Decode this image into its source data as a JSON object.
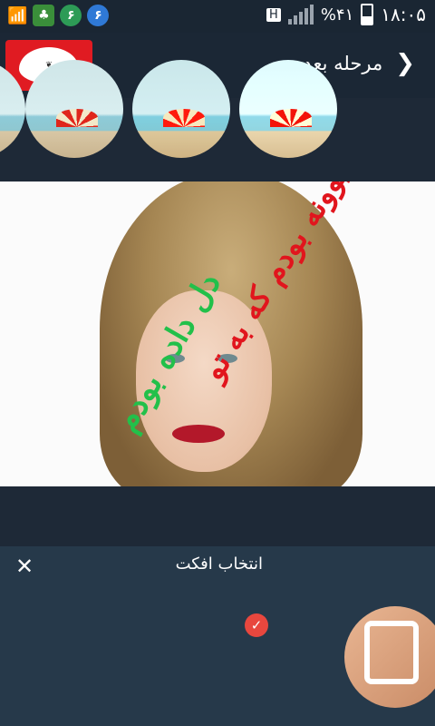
{
  "statusbar": {
    "time": "۱۸:۰۵",
    "battery": "%۴۱",
    "network_type": "H",
    "notif_count_1": "۶",
    "notif_count_2": "۶"
  },
  "appbar": {
    "next_label": "مرحله بعد",
    "next_icon": "chevron-right"
  },
  "photo": {
    "caption_line1": "دیوونه بودم که به تو",
    "caption_line2": "دل داده بودم"
  },
  "effects": {
    "title": "انتخاب افکت",
    "close_icon": "close-x",
    "selected_index": 3,
    "items": [
      "effect-1",
      "effect-2",
      "effect-3",
      "effect-4"
    ]
  },
  "colors": {
    "background": "#1b2735",
    "panel": "#26394a",
    "accent_check": "#e8473e",
    "logo_red": "#e01b22"
  }
}
